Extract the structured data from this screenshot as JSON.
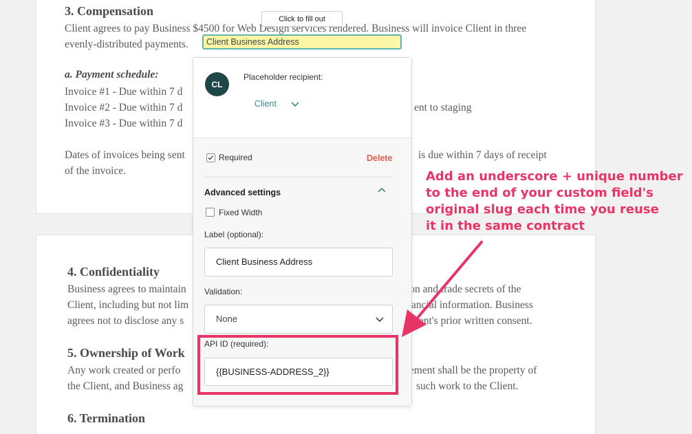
{
  "document": {
    "page1": {
      "compensation_heading": "3. Compensation",
      "compensation_line1": "Client agrees to pay Business $4500 for Web Design services rendered. Business will invoice Client in three",
      "compensation_line2": "evenly-distributed payments.",
      "payment_schedule_heading": "a. Payment schedule:",
      "invoice1": "Invoice #1 - Due within 7 d",
      "invoice2": "Invoice #2 - Due within 7 d",
      "invoice2_tail": "ent to staging",
      "invoice3": "Invoice #3 - Due within 7 d",
      "dates_line1": "Dates of invoices being sent",
      "dates_line1_tail": "is due within 7 days of receipt",
      "dates_line2": "of the invoice."
    },
    "page2": {
      "confidentiality_heading": "4. Confidentiality",
      "conf_line1": "Business agrees to maintain",
      "conf_line1_tail": "ion and trade secrets of the",
      "conf_line2": "Client, including but not lim",
      "conf_line2_tail": "ancial information. Business",
      "conf_line3": "agrees not to disclose any s",
      "conf_line3_tail": "Client's prior written consent.",
      "ownership_heading": "5. Ownership of Work",
      "own_line1": "Any work created or perfo",
      "own_line1_tail": "eement shall be the property of",
      "own_line2": "the Client, and Business ag",
      "own_line2_tail": "such work to the Client.",
      "termination_heading": "6. Termination"
    }
  },
  "tooltip": "Click to fill out",
  "field_chip": "Client Business Address",
  "popover": {
    "avatar_initials": "CL",
    "recipient_label": "Placeholder recipient:",
    "recipient_value": "Client",
    "required_label": "Required",
    "required_checked": true,
    "delete_label": "Delete",
    "advanced_title": "Advanced settings",
    "fixed_width_label": "Fixed Width",
    "fixed_width_checked": false,
    "label_field_label": "Label (optional):",
    "label_field_value": "Client Business Address",
    "validation_label": "Validation:",
    "validation_value": "None",
    "api_id_label": "API ID (required):",
    "api_id_value": "{{BUSINESS-ADDRESS_2}}"
  },
  "annotation": {
    "lines": [
      "Add an underscore + unique number",
      "to the end of your custom field's",
      "original slug each time you reuse",
      "it in the same contract"
    ],
    "color": "#e83565"
  },
  "icons": [
    "chevron-down-icon",
    "chevron-up-icon",
    "checkmark-icon",
    "arrow-annotation"
  ]
}
